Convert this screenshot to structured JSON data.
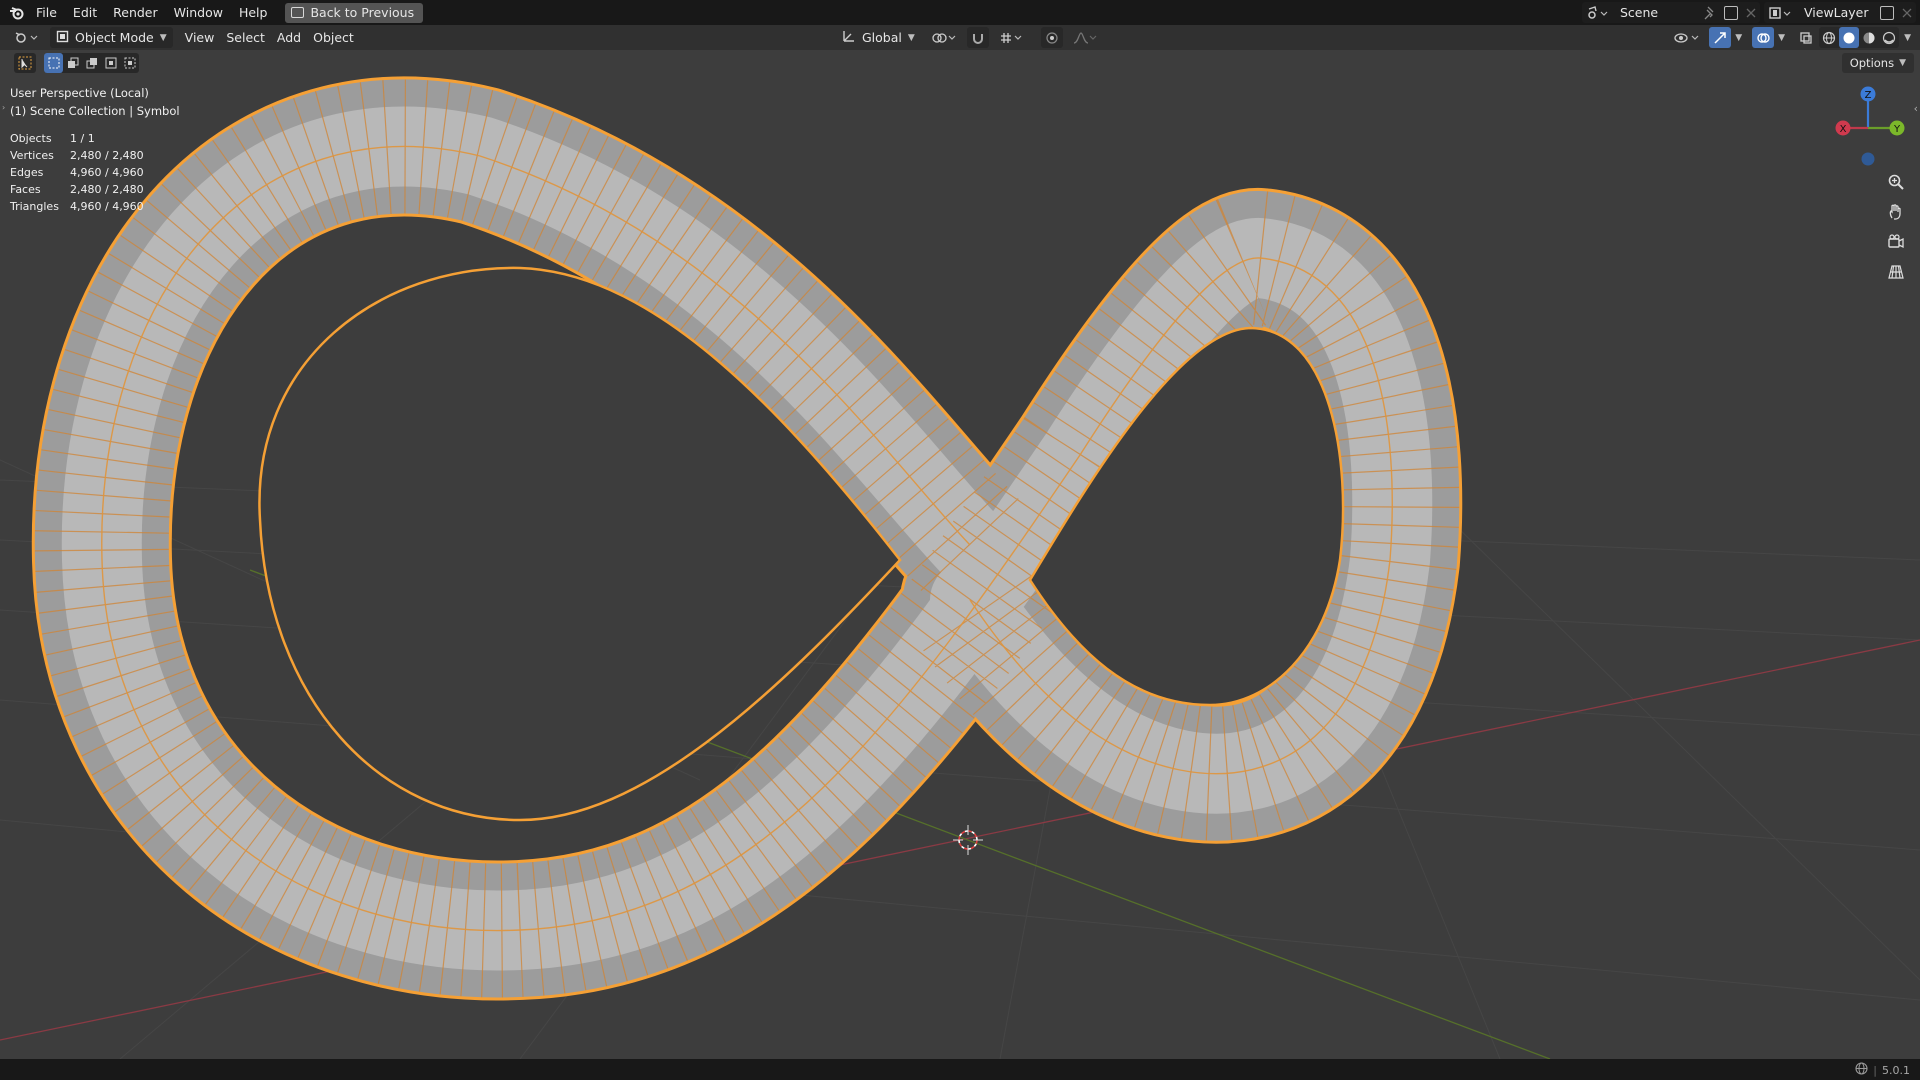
{
  "app": {
    "menu": [
      "File",
      "Edit",
      "Render",
      "Window",
      "Help"
    ],
    "back_button": "Back to Previous",
    "scene_name": "Scene",
    "view_layer": "ViewLayer"
  },
  "header": {
    "mode": "Object Mode",
    "menus": [
      "View",
      "Select",
      "Add",
      "Object"
    ],
    "transform_orientation": "Global",
    "options": "Options"
  },
  "viewport": {
    "view_name": "User Perspective (Local)",
    "collection": "(1) Scene Collection | Symbol",
    "stats": [
      {
        "label": "Objects",
        "value": "1 / 1"
      },
      {
        "label": "Vertices",
        "value": "2,480 / 2,480"
      },
      {
        "label": "Edges",
        "value": "4,960 / 4,960"
      },
      {
        "label": "Faces",
        "value": "2,480 / 2,480"
      },
      {
        "label": "Triangles",
        "value": "4,960 / 4,960"
      }
    ],
    "gizmo_axes": {
      "x": "X",
      "y": "Y",
      "z": "Z"
    }
  },
  "status": {
    "version": "5.0.1"
  },
  "colors": {
    "selection_outline": "#f5a035",
    "axis_x": "#c04050",
    "axis_y": "#6a8a30",
    "accent": "#4772b3"
  }
}
